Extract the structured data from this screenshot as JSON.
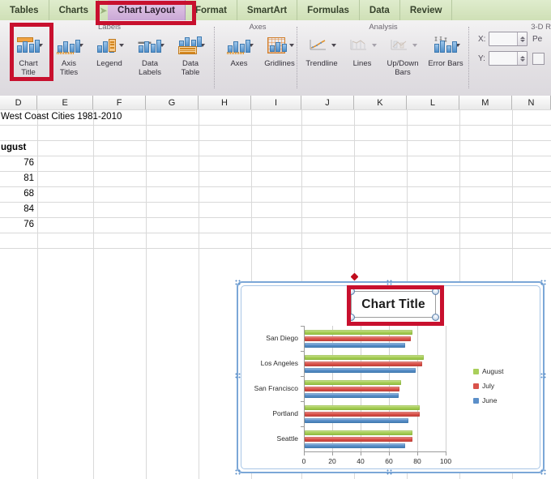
{
  "ribbon": {
    "tabs": [
      {
        "label": "Tables",
        "active": false
      },
      {
        "label": "Charts",
        "active": false
      },
      {
        "label": "Chart Layout",
        "active": true
      },
      {
        "label": "Format",
        "active": false
      },
      {
        "label": "SmartArt",
        "active": false
      },
      {
        "label": "Formulas",
        "active": false
      },
      {
        "label": "Data",
        "active": false
      },
      {
        "label": "Review",
        "active": false
      }
    ],
    "groups": [
      {
        "title": "Labels"
      },
      {
        "title": "Axes"
      },
      {
        "title": "Analysis"
      },
      {
        "title": "3-D R"
      }
    ],
    "labels_group": [
      {
        "name": "chart-title",
        "label_line1": "Chart",
        "label_line2": "Title",
        "has_caret": true
      },
      {
        "name": "axis-titles",
        "label_line1": "Axis",
        "label_line2": "Titles",
        "has_caret": true
      },
      {
        "name": "legend",
        "label_line1": "Legend",
        "label_line2": "",
        "has_caret": true
      },
      {
        "name": "data-labels",
        "label_line1": "Data",
        "label_line2": "Labels",
        "has_caret": true
      },
      {
        "name": "data-table",
        "label_line1": "Data",
        "label_line2": "Table",
        "has_caret": true
      }
    ],
    "axes_group": [
      {
        "name": "axes",
        "label_line1": "Axes",
        "label_line2": "",
        "has_caret": true
      },
      {
        "name": "gridlines",
        "label_line1": "Gridlines",
        "label_line2": "",
        "has_caret": true
      }
    ],
    "analysis_group": [
      {
        "name": "trendline",
        "label_line1": "Trendline",
        "label_line2": "",
        "has_caret": true,
        "dim": false
      },
      {
        "name": "lines",
        "label_line1": "Lines",
        "label_line2": "",
        "has_caret": true,
        "dim": true
      },
      {
        "name": "updown-bars",
        "label_line1": "Up/Down",
        "label_line2": "Bars",
        "has_caret": true,
        "dim": true
      },
      {
        "name": "error-bars",
        "label_line1": "Error Bars",
        "label_line2": "",
        "has_caret": true,
        "dim": false
      }
    ],
    "rotation": {
      "x_label": "X:",
      "y_label": "Y:",
      "x_value": "",
      "y_value": "",
      "perspective_label": "Pe"
    }
  },
  "sheet": {
    "columns": [
      "D",
      "E",
      "F",
      "G",
      "H",
      "I",
      "J",
      "K",
      "L",
      "M",
      "N"
    ],
    "cells": [
      {
        "text": "West Coast Cities 1981-2010",
        "col": 0,
        "row": 0,
        "bold": false,
        "align": "left"
      },
      {
        "text": "ugust",
        "col": 0,
        "row": 2,
        "bold": true,
        "align": "left"
      },
      {
        "text": "76",
        "col": 0,
        "row": 3,
        "bold": false,
        "align": "right"
      },
      {
        "text": "81",
        "col": 0,
        "row": 4,
        "bold": false,
        "align": "right"
      },
      {
        "text": "68",
        "col": 0,
        "row": 5,
        "bold": false,
        "align": "right"
      },
      {
        "text": "84",
        "col": 0,
        "row": 6,
        "bold": false,
        "align": "right"
      },
      {
        "text": "76",
        "col": 0,
        "row": 7,
        "bold": false,
        "align": "right"
      }
    ]
  },
  "chart": {
    "title": "Chart Title",
    "selected": true
  },
  "chart_data": {
    "type": "bar",
    "orientation": "horizontal",
    "title": "Chart Title",
    "xlabel": "",
    "ylabel": "",
    "categories": [
      "Seattle",
      "Portland",
      "San Francisco",
      "Los Angeles",
      "San Diego"
    ],
    "category_order_top_to_bottom": [
      "San Diego",
      "Los Angeles",
      "San Francisco",
      "Portland",
      "Seattle"
    ],
    "series": [
      {
        "name": "June",
        "color": "#5b8fc9",
        "values": [
          71,
          73,
          66,
          78,
          71
        ]
      },
      {
        "name": "July",
        "color": "#d9524a",
        "values": [
          76,
          81,
          67,
          83,
          75
        ]
      },
      {
        "name": "August",
        "color": "#a9cf5a",
        "values": [
          76,
          81,
          68,
          84,
          76
        ]
      }
    ],
    "xlim": [
      0,
      100
    ],
    "xticks": [
      0,
      20,
      40,
      60,
      80,
      100
    ],
    "xtick_labels": [
      "0",
      "20",
      "40",
      "60",
      "80",
      "100"
    ],
    "gridlines": "vertical",
    "legend": {
      "position": "right",
      "entries": [
        {
          "label": "August",
          "color": "#a9cf5a"
        },
        {
          "label": "July",
          "color": "#d9524a"
        },
        {
          "label": "June",
          "color": "#5b8fc9"
        }
      ]
    }
  },
  "annotations": {
    "highlight_color": "#c8102e",
    "boxes": [
      "chart-title-ribbon-button",
      "chart-layout-tab",
      "chart-title-text-on-chart"
    ]
  }
}
